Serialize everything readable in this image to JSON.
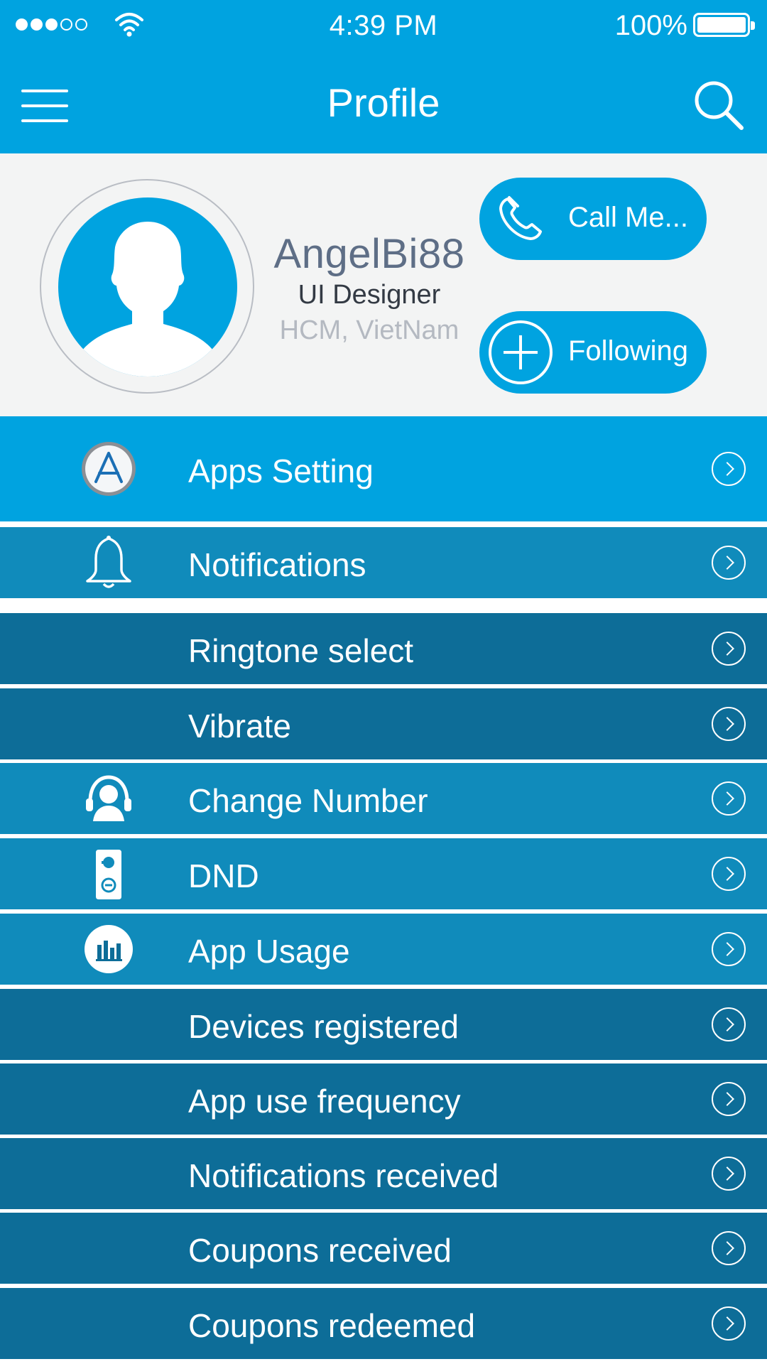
{
  "status_bar": {
    "time": "4:39 PM",
    "battery": "100%",
    "signal_icon": "signal-dots-icon",
    "wifi_icon": "wifi-icon",
    "battery_icon": "battery-icon"
  },
  "header": {
    "title": "Profile",
    "menu_icon": "hamburger-menu-icon",
    "search_icon": "search-icon"
  },
  "profile": {
    "username": "AngelBi88",
    "role": "UI Designer",
    "location": "HCM, VietNam",
    "call_button": "Call Me...",
    "follow_button": "Following"
  },
  "menu": {
    "items": [
      {
        "label": "Apps Setting",
        "icon": "app-store-icon"
      },
      {
        "label": "Notifications",
        "icon": "bell-icon"
      },
      {
        "label": "Ringtone select",
        "icon": ""
      },
      {
        "label": "Vibrate",
        "icon": ""
      },
      {
        "label": "Change Number",
        "icon": "user-headset-icon"
      },
      {
        "label": "DND",
        "icon": "door-hanger-icon"
      },
      {
        "label": "App Usage",
        "icon": "bar-chart-icon"
      },
      {
        "label": "Devices registered",
        "icon": ""
      },
      {
        "label": "App use frequency",
        "icon": ""
      },
      {
        "label": "Notifications received",
        "icon": ""
      },
      {
        "label": "Coupons received",
        "icon": ""
      },
      {
        "label": "Coupons redeemed",
        "icon": ""
      }
    ]
  },
  "colors": {
    "primary": "#00a3e0",
    "row_mid": "#108bbb",
    "row_dark": "#0d6d98",
    "profile_bg": "#f3f4f4"
  }
}
